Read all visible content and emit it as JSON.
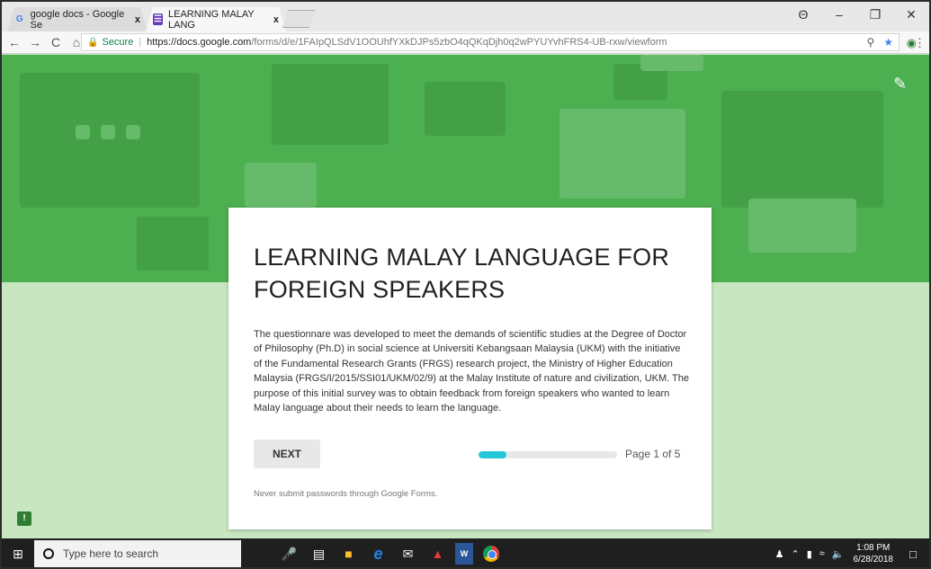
{
  "browser": {
    "tabs": [
      {
        "label": "google docs - Google Se",
        "favicon": "G",
        "close": "x"
      },
      {
        "label": "LEARNING MALAY LANG",
        "favicon": "☰",
        "close": "x"
      }
    ],
    "window_controls": {
      "minimize": "–",
      "restore": "❐",
      "close": "✕",
      "profile": "Θ"
    },
    "nav": {
      "back": "←",
      "forward": "→",
      "reload": "C",
      "home": "⌂"
    },
    "address": {
      "secure_label": "Secure",
      "url_host": "https://docs.google.com",
      "url_path": "/forms/d/e/1FAIpQLSdV1OOUhfYXkDJPs5zbO4qQKqDjh0q2wPYUYvhFRS4-UB-rxw/viewform"
    }
  },
  "form": {
    "title": "LEARNING MALAY LANGUAGE FOR FOREIGN SPEAKERS",
    "description": "The questionnare was developed to meet the demands of scientific studies at the Degree of Doctor of Philosophy (Ph.D) in social science at Universiti Kebangsaan Malaysia (UKM) with the initiative of the Fundamental Research Grants (FRGS) research project, the Ministry of Higher Education Malaysia (FRGS/I/2015/SSI01/UKM/02/9) at the Malay Institute of nature and civilization, UKM. The purpose of this initial survey was to obtain feedback from foreign speakers who wanted to learn Malay language about their needs to learn the language.",
    "next_label": "NEXT",
    "page_indicator": "Page 1 of 5",
    "progress_fraction": 0.2,
    "warning": "Never submit passwords through Google Forms.",
    "colors": {
      "banner": "#4caf50",
      "background": "#c8e6c0",
      "progress": "#26c6da"
    }
  },
  "taskbar": {
    "search_placeholder": "Type here to search",
    "time": "1:08 PM",
    "date": "6/28/2018"
  }
}
